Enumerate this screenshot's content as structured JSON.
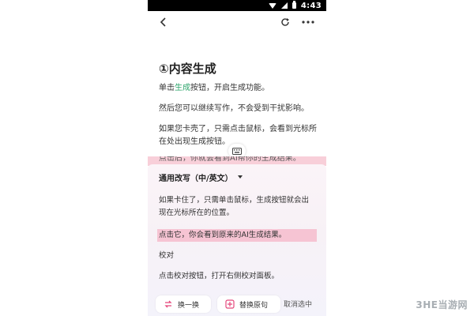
{
  "status_bar": {
    "time": "4:43"
  },
  "document": {
    "title": "①内容生成",
    "para1_before": "单击",
    "para1_link": "生成",
    "para1_after": "按钮，开启生成功能。",
    "para2": "然后您可以继续写作，不会受到干扰影响。",
    "para3_line1": "如果您卡壳了，只需点击鼠标，会看到光标所",
    "para3_line2": "在处出现生成按钮。",
    "para4_partial": "点击后，你就会看到AI帮你的生成结果。"
  },
  "panel": {
    "mode_label": "通用改写（中/英文）",
    "text_line1": "如果卡住了，只需单击鼠标，生成按钮就会出",
    "text_line2": "现在光标所在的位置。",
    "text_highlight": "点击它，你会看到原来的AI生成结果。",
    "text_heading": "校对",
    "text_line3": "点击校对按钮，打开右侧校对面板。"
  },
  "actions": {
    "swap_label": "换一换",
    "replace_label": "替换原句",
    "cancel_label": "取消选中"
  },
  "watermark": "3HE当游网",
  "colors": {
    "accent_green": "#2da56b",
    "highlight_pink": "#f6c4d3",
    "icon_pink": "#e5467b"
  }
}
